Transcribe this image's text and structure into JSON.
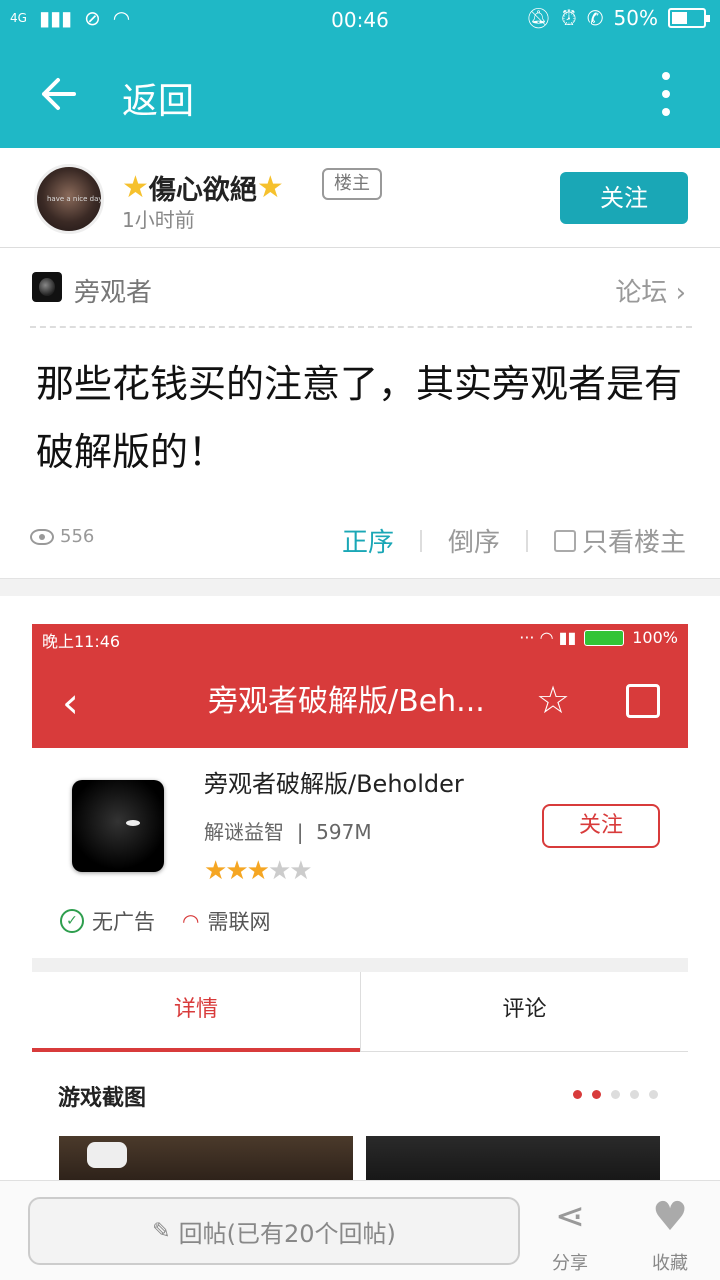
{
  "status_bar": {
    "network": "4G",
    "time": "00:46",
    "battery": "50%",
    "battery_level": 0.5
  },
  "header": {
    "back_label": "返回"
  },
  "author": {
    "name": "傷心欲絕",
    "avatar_caption": "have a nice day.",
    "tag": "楼主",
    "time_ago": "1小时前",
    "follow_label": "关注"
  },
  "forum": {
    "name": "旁观者",
    "link_label": "论坛"
  },
  "post": {
    "title": "那些花钱买的注意了，其实旁观者是有破解版的！",
    "views": "556",
    "sort_asc": "正序",
    "sort_desc": "倒序",
    "only_op": "只看楼主"
  },
  "embedded_screenshot": {
    "status_time": "晚上11:46",
    "status_battery": "100%",
    "title": "旁观者破解版/Beh...",
    "app_name": "旁观者破解版/Beholder",
    "category": "解谜益智",
    "size": "597M",
    "rating": 3,
    "rating_max": 5,
    "follow_label": "关注",
    "no_ads": "无广告",
    "needs_network": "需联网",
    "tab_detail": "详情",
    "tab_comments": "评论",
    "screenshots_label": "游戏截图",
    "accent_color": "#d83b3b"
  },
  "bottom_bar": {
    "reply_placeholder": "回帖(已有20个回帖)",
    "share_label": "分享",
    "favorite_label": "收藏"
  },
  "colors": {
    "brand": "#1fb8c6",
    "accent": "#1aa7b6"
  }
}
